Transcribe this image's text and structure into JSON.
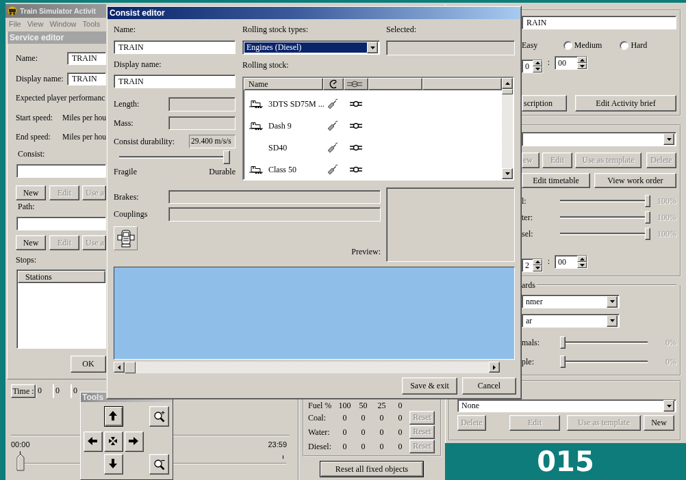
{
  "main_window": {
    "title": "Train Simulator Activit",
    "menu": [
      "File",
      "View",
      "Window",
      "Tools"
    ]
  },
  "service_editor": {
    "title": "Service editor",
    "fields": [
      {
        "label": "Name:",
        "value": "TRAIN"
      },
      {
        "label": "Display name:",
        "value": "TRAIN"
      }
    ],
    "performance_label": "Expected player performanc",
    "speeds": [
      {
        "label": "Start speed:",
        "unit": "Miles per hou"
      },
      {
        "label": "End speed:",
        "unit": "Miles per hou"
      }
    ],
    "sections": [
      {
        "label": "Consist:",
        "buttons": [
          {
            "label": "New",
            "disabled": false
          },
          {
            "label": "Edit",
            "disabled": true
          },
          {
            "label": "Use a",
            "disabled": true
          }
        ]
      },
      {
        "label": "Path:",
        "buttons": [
          {
            "label": "New",
            "disabled": false
          },
          {
            "label": "Edit",
            "disabled": true
          },
          {
            "label": "Use a",
            "disabled": true
          }
        ]
      }
    ],
    "stops_label": "Stops:",
    "stops_columns": [
      "Stations"
    ],
    "ok_button": "OK"
  },
  "time_bar": {
    "button": "Time :",
    "cells": [
      "0",
      "0",
      "0"
    ]
  },
  "timeline": {
    "start": "00:00",
    "end": "23:59",
    "level": 0
  },
  "tools": {
    "title": "Tools"
  },
  "fuel_table": {
    "header": [
      "Fuel %",
      "100",
      "50",
      "25",
      "0"
    ],
    "rows": [
      {
        "label": "Coal:",
        "values": [
          "0",
          "0",
          "0",
          "0"
        ],
        "button": "Reset",
        "disabled": true
      },
      {
        "label": "Water:",
        "values": [
          "0",
          "0",
          "0",
          "0"
        ],
        "button": "Reset",
        "disabled": true
      },
      {
        "label": "Diesel:",
        "values": [
          "0",
          "0",
          "0",
          "0"
        ],
        "button": "Reset",
        "disabled": true
      }
    ],
    "reset_all_button": "Reset all fixed objects"
  },
  "activity": {
    "name_value": "RAIN",
    "difficulty": {
      "first_label": "Easy",
      "options": [
        {
          "label": "Medium",
          "checked": false
        },
        {
          "label": "Hard",
          "checked": false
        }
      ]
    },
    "start_time": {
      "hours": "0",
      "separator": ":",
      "minutes": "00"
    },
    "buttons": [
      {
        "label": "scription",
        "disabled": false
      },
      {
        "label": "Edit Activity brief",
        "disabled": false
      }
    ]
  },
  "player": {
    "buttons": [
      {
        "label": "ew",
        "disabled": true
      },
      {
        "label": "Edit",
        "disabled": true
      },
      {
        "label": "Use as template",
        "disabled": true
      },
      {
        "label": "Delete",
        "disabled": true
      }
    ],
    "timetable_buttons": [
      {
        "label": "Edit timetable",
        "disabled": false
      },
      {
        "label": "View work order",
        "disabled": false
      }
    ],
    "sliders": [
      {
        "label": "l:",
        "level": 1,
        "reading": "100%"
      },
      {
        "label": "ter:",
        "level": 1,
        "reading": "100%"
      },
      {
        "label": "sel:",
        "level": 1,
        "reading": "100%"
      }
    ],
    "time": {
      "hours": "2",
      "separator": ":",
      "minutes": "00"
    }
  },
  "hazards": {
    "legend": "ards",
    "dropdowns": [
      "nmer",
      "ar"
    ],
    "sliders": [
      {
        "label": "mals:",
        "level": 0,
        "reading": "0%"
      },
      {
        "label": "ple:",
        "level": 0,
        "reading": "0%"
      }
    ]
  },
  "traffic": {
    "dropdown": "None",
    "buttons": [
      {
        "label": "Delete",
        "disabled": true
      },
      {
        "label": "Edit",
        "disabled": true
      },
      {
        "label": "Use as template",
        "disabled": true
      },
      {
        "label": "New",
        "disabled": false
      }
    ]
  },
  "consist_editor": {
    "title": "Consist editor",
    "name_label": "Name:",
    "name_value": "TRAIN",
    "display_name_label": "Display name:",
    "display_name_value": "TRAIN",
    "types_label": "Rolling stock types:",
    "types_value": "Engines (Diesel)",
    "types_highlighted": true,
    "selected_label": "Selected:",
    "stock_label": "Rolling stock:",
    "stock_columns": [
      "Name"
    ],
    "stock": [
      {
        "name": "3DTS SD75M ...",
        "engine_icon": true
      },
      {
        "name": "Dash 9",
        "engine_icon": true
      },
      {
        "name": "SD40",
        "engine_icon": false
      },
      {
        "name": "Class 50",
        "engine_icon": true
      }
    ],
    "properties": [
      {
        "label": "Length:"
      },
      {
        "label": "Mass:"
      }
    ],
    "durability_label": "Consist durability:",
    "durability_value": "29.400 m/s/s",
    "durability_slider": {
      "level": 1
    },
    "fragile_label": "Fragile",
    "durable_label": "Durable",
    "brakes_label": "Brakes:",
    "couplings_label": "Couplings",
    "preview_label": "Preview:",
    "buttons": [
      {
        "label": "Save & exit"
      },
      {
        "label": "Cancel"
      }
    ]
  },
  "page_number": "015"
}
